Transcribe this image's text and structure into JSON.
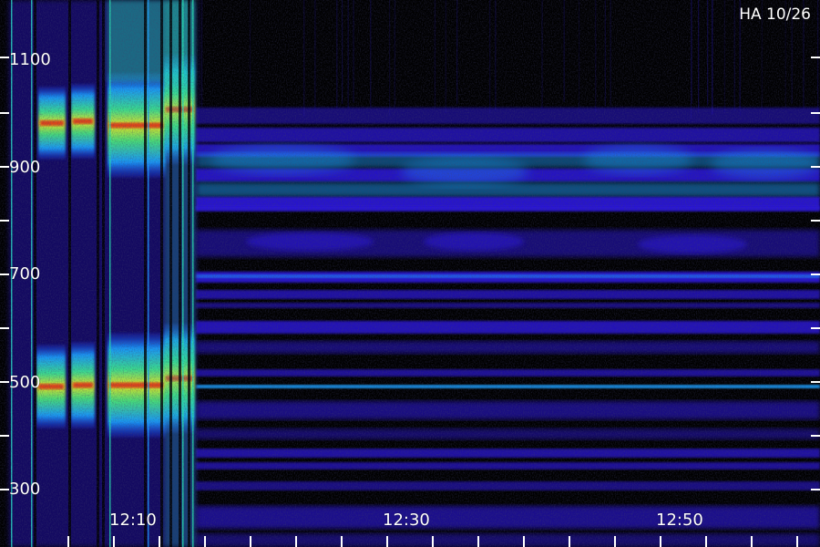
{
  "plot": {
    "title": "HA 10/26",
    "y_tick_labels": [
      "1100",
      "900",
      "700",
      "500",
      "300"
    ],
    "x_tick_labels": [
      "12:10",
      "12:30",
      "12:50"
    ]
  },
  "colors": {
    "background": "#000000",
    "low": "#2a18d8",
    "mid": "#1aa0ff",
    "high": "#28e0b0",
    "peak": "#f2f21c",
    "max": "#e02818",
    "axis": "#ffffff"
  }
}
